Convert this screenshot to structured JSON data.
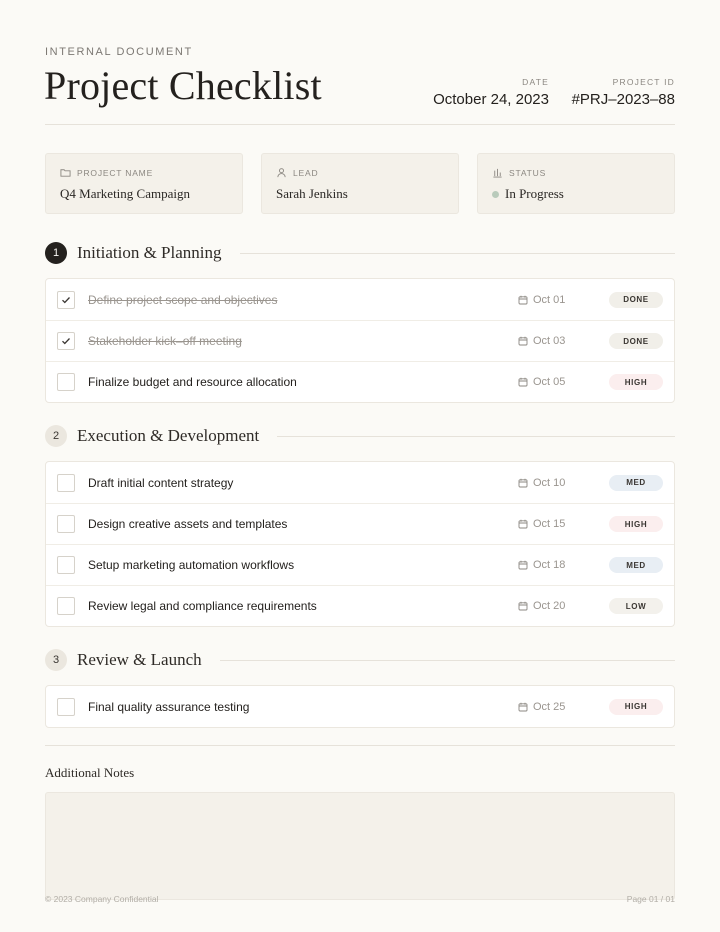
{
  "header": {
    "eyebrow": "INTERNAL DOCUMENT",
    "title": "Project Checklist",
    "date_label": "DATE",
    "date_value": "October 24, 2023",
    "project_id_label": "PROJECT ID",
    "project_id_value": "#PRJ–2023–88"
  },
  "info_cards": [
    {
      "label": "PROJECT NAME",
      "value": "Q4 Marketing Campaign",
      "icon": "folder-icon"
    },
    {
      "label": "LEAD",
      "value": "Sarah Jenkins",
      "icon": "user-icon"
    },
    {
      "label": "STATUS",
      "value": "In Progress",
      "icon": "bar-chart-icon"
    }
  ],
  "sections": [
    {
      "number": "1",
      "title": "Initiation & Planning",
      "tasks": [
        {
          "text": "Define project scope and objectives",
          "due": "Oct 01",
          "badge": "DONE",
          "checked": true
        },
        {
          "text": "Stakeholder kick–off meeting",
          "due": "Oct 03",
          "badge": "DONE",
          "checked": true
        },
        {
          "text": "Finalize budget and resource allocation",
          "due": "Oct 05",
          "badge": "HIGH",
          "checked": false
        }
      ]
    },
    {
      "number": "2",
      "title": "Execution & Development",
      "tasks": [
        {
          "text": "Draft initial content strategy",
          "due": "Oct 10",
          "badge": "MED",
          "checked": false
        },
        {
          "text": "Design creative assets and templates",
          "due": "Oct 15",
          "badge": "HIGH",
          "checked": false
        },
        {
          "text": "Setup marketing automation workflows",
          "due": "Oct 18",
          "badge": "MED",
          "checked": false
        },
        {
          "text": "Review legal and compliance requirements",
          "due": "Oct 20",
          "badge": "LOW",
          "checked": false
        }
      ]
    },
    {
      "number": "3",
      "title": "Review & Launch",
      "tasks": [
        {
          "text": "Final quality assurance testing",
          "due": "Oct 25",
          "badge": "HIGH",
          "checked": false
        }
      ]
    }
  ],
  "notes": {
    "title": "Additional Notes",
    "value": ""
  },
  "footer": {
    "left": "© 2023 Company Confidential",
    "right": "Page 01 / 01"
  },
  "colors": {
    "background": "#fbfaf6",
    "badge_done": "#f1efe9",
    "badge_high": "#fbeeee",
    "badge_med": "#e8eef4",
    "badge_low": "#f3f1ec",
    "status_dot": "#b9cbbb",
    "active_step": "#24211e"
  }
}
